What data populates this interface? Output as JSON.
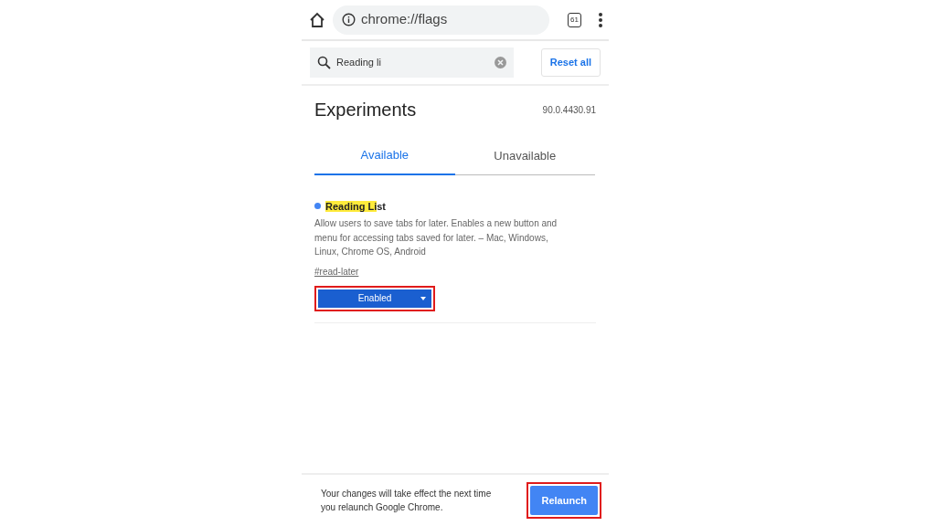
{
  "toolbar": {
    "url": "chrome://flags",
    "tab_count": "61"
  },
  "search": {
    "value": "Reading li",
    "reset_label": "Reset all"
  },
  "header": {
    "title": "Experiments",
    "version": "90.0.4430.91"
  },
  "tabs": [
    {
      "label": "Available",
      "selected": true
    },
    {
      "label": "Unavailable",
      "selected": false
    }
  ],
  "flags": [
    {
      "title_parts": [
        {
          "text": "Reading Li",
          "highlighted": true
        },
        {
          "text": "st",
          "highlighted": false
        }
      ],
      "color": "#4285f4",
      "description": "Allow users to save tabs for later. Enables a new button and menu for accessing tabs saved for later. – Mac, Windows, Linux, Chrome OS, Android",
      "link": "#read-later",
      "value": "Enabled",
      "annotated": true
    }
  ],
  "footer": {
    "message": "Your changes will take effect the next time you relaunch Google Chrome.",
    "button": "Relaunch",
    "annotated": true
  }
}
